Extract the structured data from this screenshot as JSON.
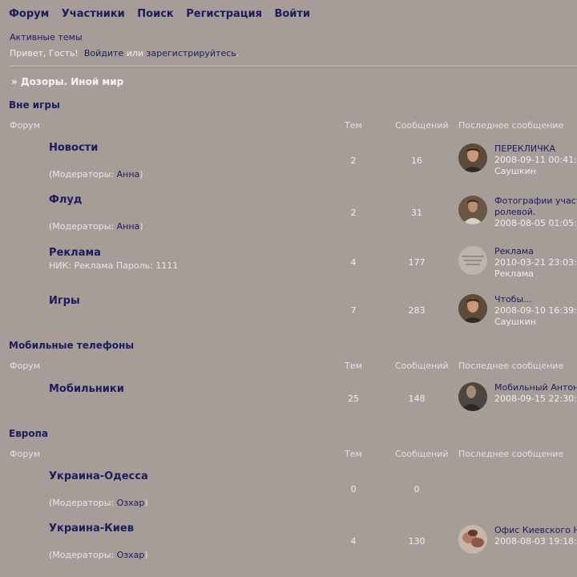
{
  "nav": {
    "forum": "Форум",
    "members": "Участники",
    "search": "Поиск",
    "register": "Регистрация",
    "login": "Войти"
  },
  "active_topics": "Активные темы",
  "greeting": {
    "hello": "Привет, Гость!",
    "login": "Войдите",
    "or": "или",
    "register": "зарегистрируйтесь",
    "dot": "."
  },
  "breadcrumb": "» Дозоры. Иной мир",
  "headers": {
    "forum": "Форум",
    "topics": "Тем",
    "posts": "Сообщений",
    "last": "Последнее сообщение"
  },
  "mod_prefix": "(Модераторы: ",
  "mod_suffix": ")",
  "categories": [
    {
      "title": "Вне игры",
      "forums": [
        {
          "name": "Новости",
          "moderator": "Анна",
          "topics": "2",
          "posts": "16",
          "last": {
            "title": "ПЕРЕКЛИЧКА",
            "date": "2008-09-11 00:41:",
            "user": "Саушкин"
          }
        },
        {
          "name": "Флуд",
          "moderator": "Анна",
          "topics": "2",
          "posts": "31",
          "last": {
            "title": "Фотографии участ",
            "title2": "ролевой.",
            "date": "2008-08-05 01:05:"
          }
        },
        {
          "name": "Реклама",
          "desc": "НИК: Реклама Пароль: 1111",
          "topics": "4",
          "posts": "177",
          "last": {
            "title": "Реклама",
            "date": "2010-03-21 23:03:",
            "user": "Реклама"
          }
        },
        {
          "name": "Игры",
          "topics": "7",
          "posts": "283",
          "last": {
            "title": "Чтобы...",
            "date": "2008-09-10 16:39:",
            "user": "Саушкин"
          }
        }
      ]
    },
    {
      "title": "Мобильные телефоны",
      "forums": [
        {
          "name": "Мобильники",
          "topics": "25",
          "posts": "148",
          "last": {
            "title": "Мобильный Антон",
            "date": "2008-09-15 22:30:"
          }
        }
      ]
    },
    {
      "title": "Европа",
      "forums": [
        {
          "name": "Украина-Одесса",
          "moderator": "Озхар",
          "topics": "0",
          "posts": "0"
        },
        {
          "name": "Украина-Киев",
          "moderator": "Озхар",
          "topics": "4",
          "posts": "130",
          "last": {
            "title": "Офис Киевского Н",
            "date": "2008-08-03 19:18:"
          }
        }
      ]
    }
  ]
}
